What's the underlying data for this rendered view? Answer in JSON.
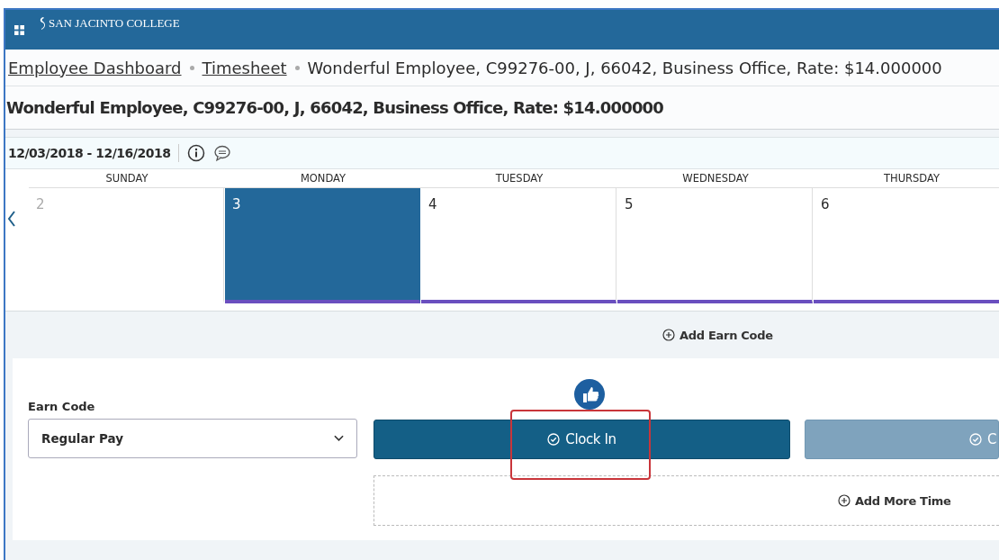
{
  "header": {
    "logo": "SAN JACINTO COLLEGE"
  },
  "breadcrumb": [
    {
      "label": "Employee Dashboard",
      "kind": "link"
    },
    {
      "label": "Timesheet",
      "kind": "link"
    },
    {
      "label": "Wonderful Employee, C99276-00, J, 66042, Business Office, Rate: $14.000000",
      "kind": "current"
    }
  ],
  "title": "Wonderful Employee, C99276-00, J, 66042, Business Office, Rate: $14.000000",
  "period": {
    "range": "12/03/2018 - 12/16/2018"
  },
  "days": [
    {
      "weekday": "SUNDAY",
      "date": "2",
      "selected": false,
      "muted": true
    },
    {
      "weekday": "MONDAY",
      "date": "3",
      "selected": true,
      "muted": false
    },
    {
      "weekday": "TUESDAY",
      "date": "4",
      "selected": false,
      "muted": false
    },
    {
      "weekday": "WEDNESDAY",
      "date": "5",
      "selected": false,
      "muted": false
    },
    {
      "weekday": "THURSDAY",
      "date": "6",
      "selected": false,
      "muted": false
    }
  ],
  "add_earn_code": "Add Earn Code",
  "entry": {
    "earn_code_label": "Earn Code",
    "earn_code_value": "Regular Pay",
    "buttons": [
      {
        "label": "Clock In",
        "disabled": false,
        "highlighted": true
      },
      {
        "label": "C",
        "disabled": true,
        "highlighted": false
      }
    ],
    "add_more_time": "Add More Time"
  }
}
